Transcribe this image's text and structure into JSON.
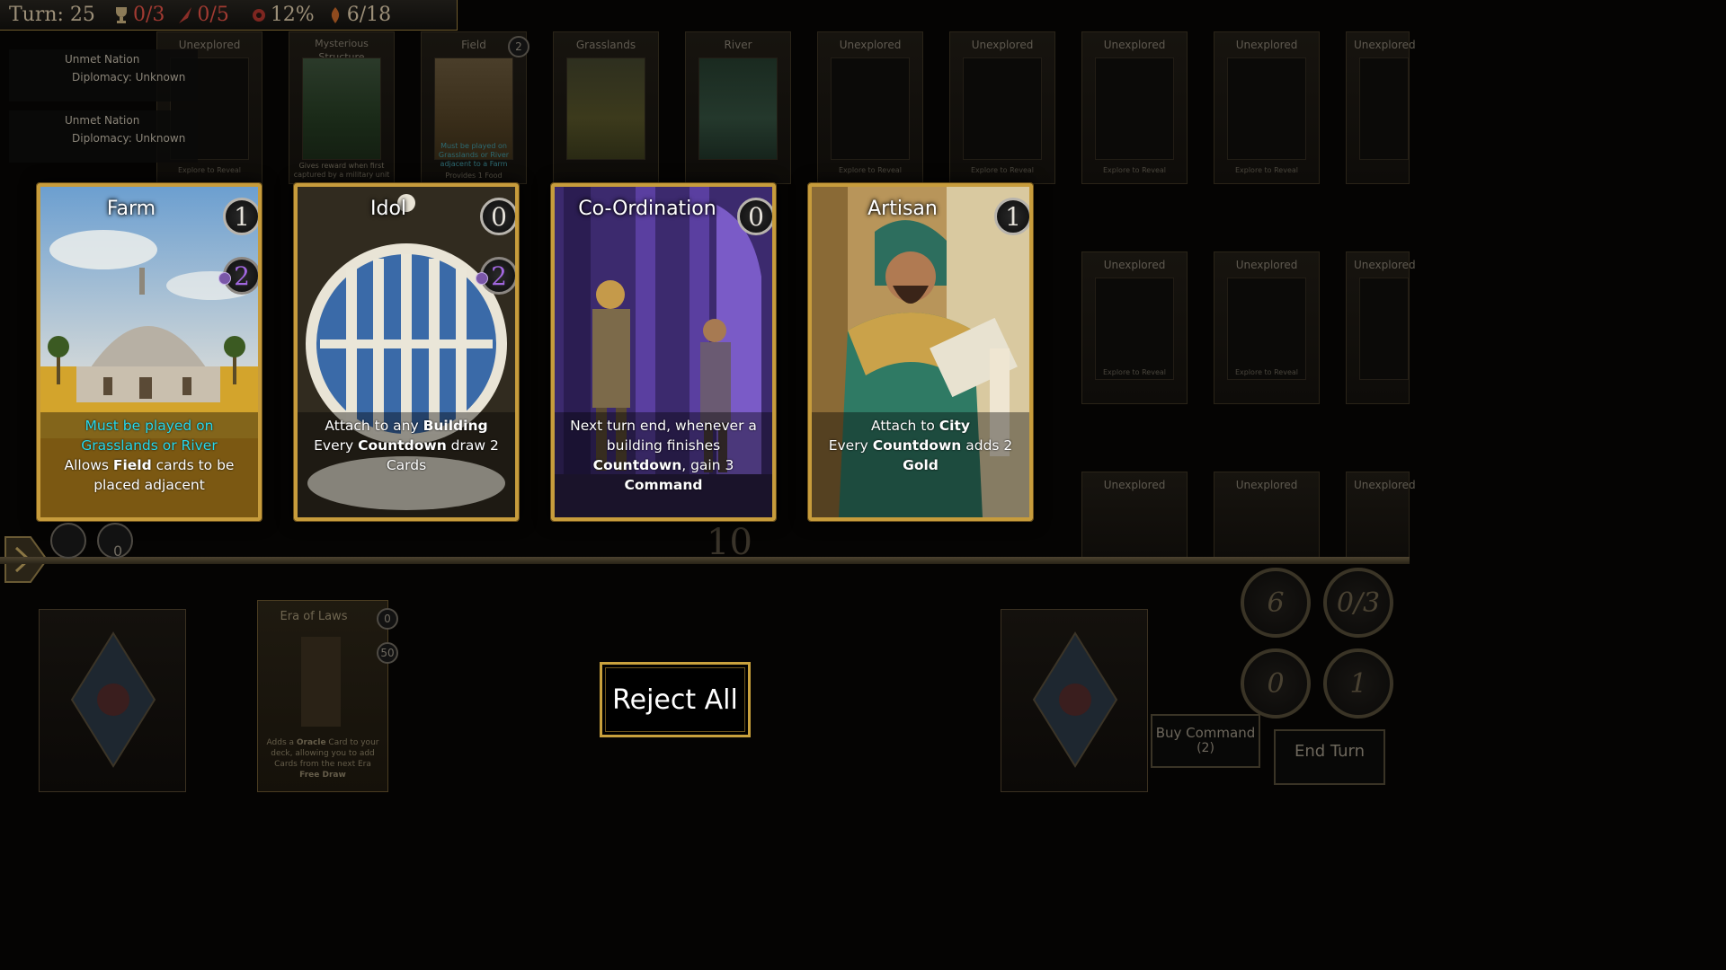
{
  "hud": {
    "turn": "Turn: 25",
    "trophies": "0/3",
    "military": "0/5",
    "unrest": "12%",
    "population": "6/18"
  },
  "nations": [
    {
      "name": "Unmet Nation",
      "diplomacy": "Diplomacy: Unknown"
    },
    {
      "name": "Unmet Nation",
      "diplomacy": "Diplomacy: Unknown"
    }
  ],
  "board_tiles": {
    "unexplored": "Unexplored",
    "explore_hint": "Explore to Reveal",
    "mysterious": "Mysterious Structure",
    "mysterious_desc": "Gives reward when first captured by a military unit",
    "field": "Field",
    "field_desc_1": "Must be played on Grasslands or River adjacent to a Farm",
    "field_desc_2": "Provides 1 Food",
    "grasslands": "Grasslands",
    "river": "River",
    "field_cost": "2",
    "board_number": "10"
  },
  "cards": [
    {
      "title": "Farm",
      "cost": "1",
      "gem": "2",
      "line1": "Must be played on Grasslands or River",
      "line2_pre": "Allows ",
      "line2_bold": "Field",
      "line2_post": " cards to be placed adjacent"
    },
    {
      "title": "Idol",
      "cost": "0",
      "gem": "2",
      "line1_pre": "Attach to any ",
      "line1_bold": "Building",
      "line2_pre": "Every ",
      "line2_bold": "Countdown",
      "line2_post": " draw 2 Cards"
    },
    {
      "title": "Co-Ordination",
      "cost": "0",
      "line1": "Next turn end, whenever a building finishes ",
      "line1_bold": "Countdown",
      "line2_pre": ", gain 3 ",
      "line2_bold": "Command"
    },
    {
      "title": "Artisan",
      "cost": "1",
      "line1_pre": "Attach to ",
      "line1_bold": "City",
      "line2_pre": "Every ",
      "line2_bold": "Countdown",
      "line2_mid": " adds 2 ",
      "line2_bold2": "Gold"
    }
  ],
  "rail_counter": "0",
  "era": {
    "title": "Era of Laws",
    "cost": "0",
    "gem": "50",
    "desc_pre": "Adds a ",
    "desc_bold": "Oracle",
    "desc_post": " Card to your deck, allowing you to add Cards from the next Era",
    "free": "Free Draw"
  },
  "reject_all": "Reject All",
  "resources": {
    "gold": "6",
    "command": "0/3",
    "gem": "0",
    "food": "1"
  },
  "buy_command": {
    "label": "Buy Command",
    "count": "(2)"
  },
  "end_turn": "End Turn",
  "colors": {
    "gold_border": "#c79c3c",
    "cyan_text": "#27d9ec",
    "gem_purple": "#a267e0"
  }
}
